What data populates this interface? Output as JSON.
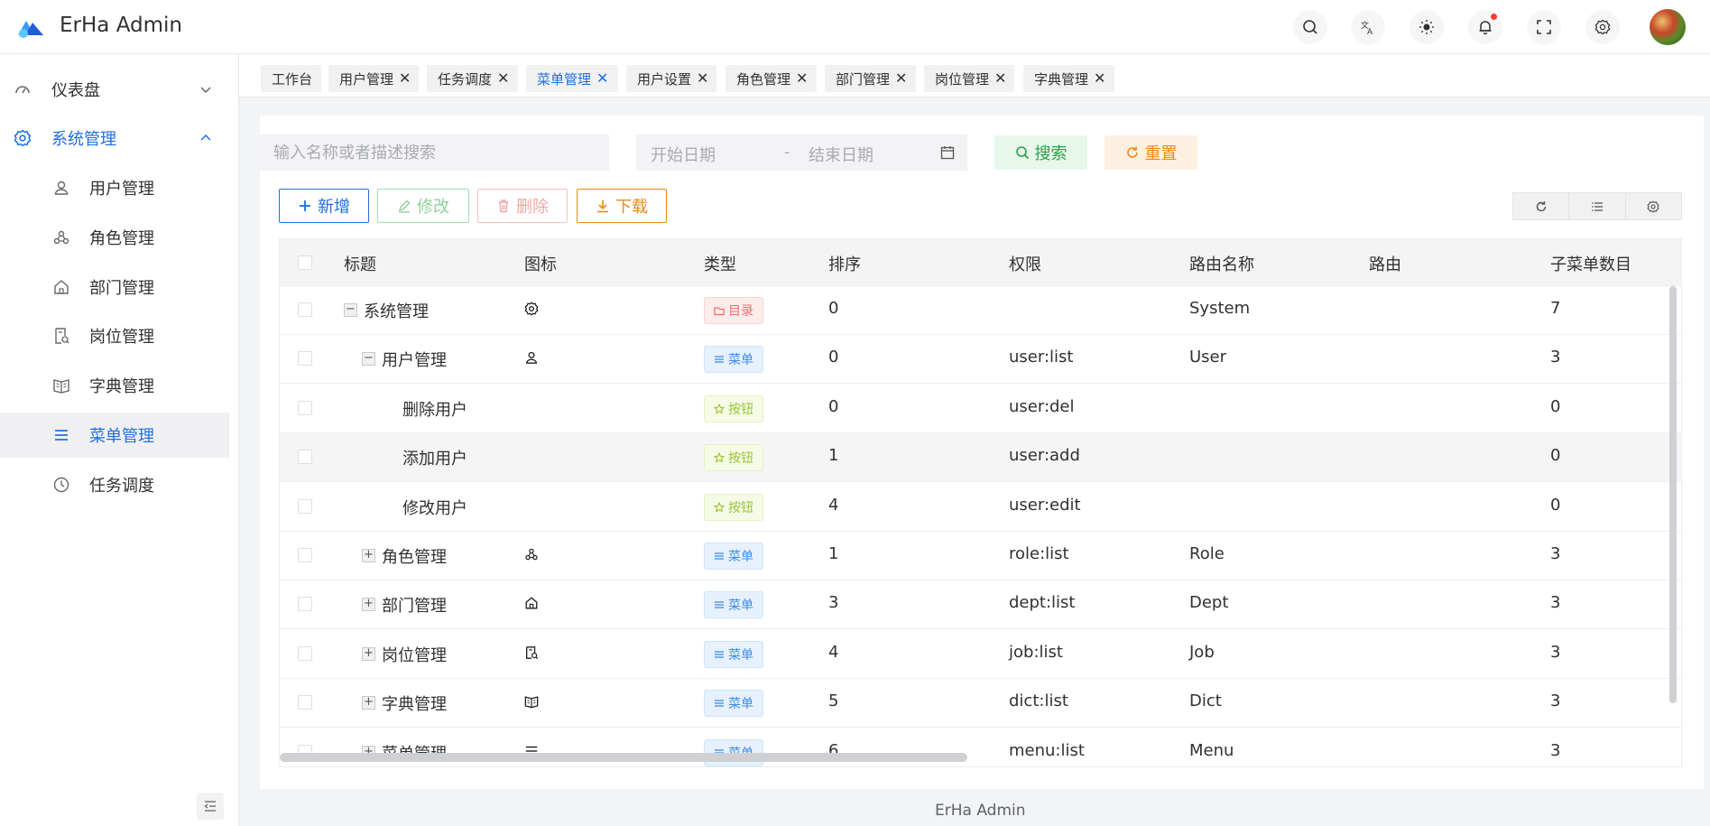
{
  "app": {
    "title": "ErHa Admin"
  },
  "header": {
    "icons": [
      "search-icon",
      "translate-icon",
      "theme-icon",
      "bell-icon",
      "fullscreen-icon",
      "gear-icon"
    ],
    "has_notification": true
  },
  "sidebar": {
    "items": [
      {
        "label": "仪表盘",
        "icon": "dashboard-icon",
        "expandable": true,
        "expanded": false
      },
      {
        "label": "系统管理",
        "icon": "gear-icon",
        "expandable": true,
        "expanded": true
      },
      {
        "label": "用户管理",
        "icon": "user-icon"
      },
      {
        "label": "角色管理",
        "icon": "role-icon"
      },
      {
        "label": "部门管理",
        "icon": "home-icon"
      },
      {
        "label": "岗位管理",
        "icon": "job-icon"
      },
      {
        "label": "字典管理",
        "icon": "book-icon"
      },
      {
        "label": "菜单管理",
        "icon": "menu-icon",
        "active": true
      },
      {
        "label": "任务调度",
        "icon": "clock-icon"
      }
    ]
  },
  "tabs": [
    {
      "label": "工作台",
      "closable": false
    },
    {
      "label": "用户管理",
      "closable": true
    },
    {
      "label": "任务调度",
      "closable": true
    },
    {
      "label": "菜单管理",
      "closable": true,
      "active": true
    },
    {
      "label": "用户设置",
      "closable": true
    },
    {
      "label": "角色管理",
      "closable": true
    },
    {
      "label": "部门管理",
      "closable": true
    },
    {
      "label": "岗位管理",
      "closable": true
    },
    {
      "label": "字典管理",
      "closable": true
    }
  ],
  "filters": {
    "search_placeholder": "输入名称或者描述搜索",
    "start_date_placeholder": "开始日期",
    "date_separator": "-",
    "end_date_placeholder": "结束日期",
    "search_label": "搜索",
    "reset_label": "重置"
  },
  "toolbar": {
    "add_label": "新增",
    "edit_label": "修改",
    "delete_label": "删除",
    "download_label": "下载"
  },
  "table": {
    "columns": [
      "标题",
      "图标",
      "类型",
      "排序",
      "权限",
      "路由名称",
      "路由",
      "子菜单数目"
    ],
    "rows": [
      {
        "title": "系统管理",
        "level": 0,
        "expander": "−",
        "icon": "gear-icon",
        "type": "目录",
        "type_kind": "dir",
        "sort": "0",
        "perm": "",
        "route_name": "System",
        "route": "",
        "children": "7"
      },
      {
        "title": "用户管理",
        "level": 1,
        "expander": "−",
        "icon": "user-icon",
        "type": "菜单",
        "type_kind": "menu",
        "sort": "0",
        "perm": "user:list",
        "route_name": "User",
        "route": "",
        "children": "3"
      },
      {
        "title": "删除用户",
        "level": 2,
        "expander": "",
        "icon": "",
        "type": "按钮",
        "type_kind": "btn",
        "sort": "0",
        "perm": "user:del",
        "route_name": "",
        "route": "",
        "children": "0"
      },
      {
        "title": "添加用户",
        "level": 2,
        "expander": "",
        "icon": "",
        "type": "按钮",
        "type_kind": "btn",
        "sort": "1",
        "perm": "user:add",
        "route_name": "",
        "route": "",
        "children": "0",
        "highlight": true
      },
      {
        "title": "修改用户",
        "level": 2,
        "expander": "",
        "icon": "",
        "type": "按钮",
        "type_kind": "btn",
        "sort": "4",
        "perm": "user:edit",
        "route_name": "",
        "route": "",
        "children": "0"
      },
      {
        "title": "角色管理",
        "level": 1,
        "expander": "+",
        "icon": "role-icon",
        "type": "菜单",
        "type_kind": "menu",
        "sort": "1",
        "perm": "role:list",
        "route_name": "Role",
        "route": "",
        "children": "3"
      },
      {
        "title": "部门管理",
        "level": 1,
        "expander": "+",
        "icon": "home-icon",
        "type": "菜单",
        "type_kind": "menu",
        "sort": "3",
        "perm": "dept:list",
        "route_name": "Dept",
        "route": "",
        "children": "3"
      },
      {
        "title": "岗位管理",
        "level": 1,
        "expander": "+",
        "icon": "job-icon",
        "type": "菜单",
        "type_kind": "menu",
        "sort": "4",
        "perm": "job:list",
        "route_name": "Job",
        "route": "",
        "children": "3"
      },
      {
        "title": "字典管理",
        "level": 1,
        "expander": "+",
        "icon": "book-icon",
        "type": "菜单",
        "type_kind": "menu",
        "sort": "5",
        "perm": "dict:list",
        "route_name": "Dict",
        "route": "",
        "children": "3"
      },
      {
        "title": "菜单管理",
        "level": 1,
        "expander": "+",
        "icon": "menu-icon",
        "type": "菜单",
        "type_kind": "menu",
        "sort": "6",
        "perm": "menu:list",
        "route_name": "Menu",
        "route": "",
        "children": "3"
      }
    ]
  },
  "footer": {
    "text": "ErHa Admin"
  },
  "colors": {
    "primary": "#1e6fe0",
    "success": "#2ca04b",
    "warning": "#e98b1a",
    "danger": "#f56c6c"
  }
}
